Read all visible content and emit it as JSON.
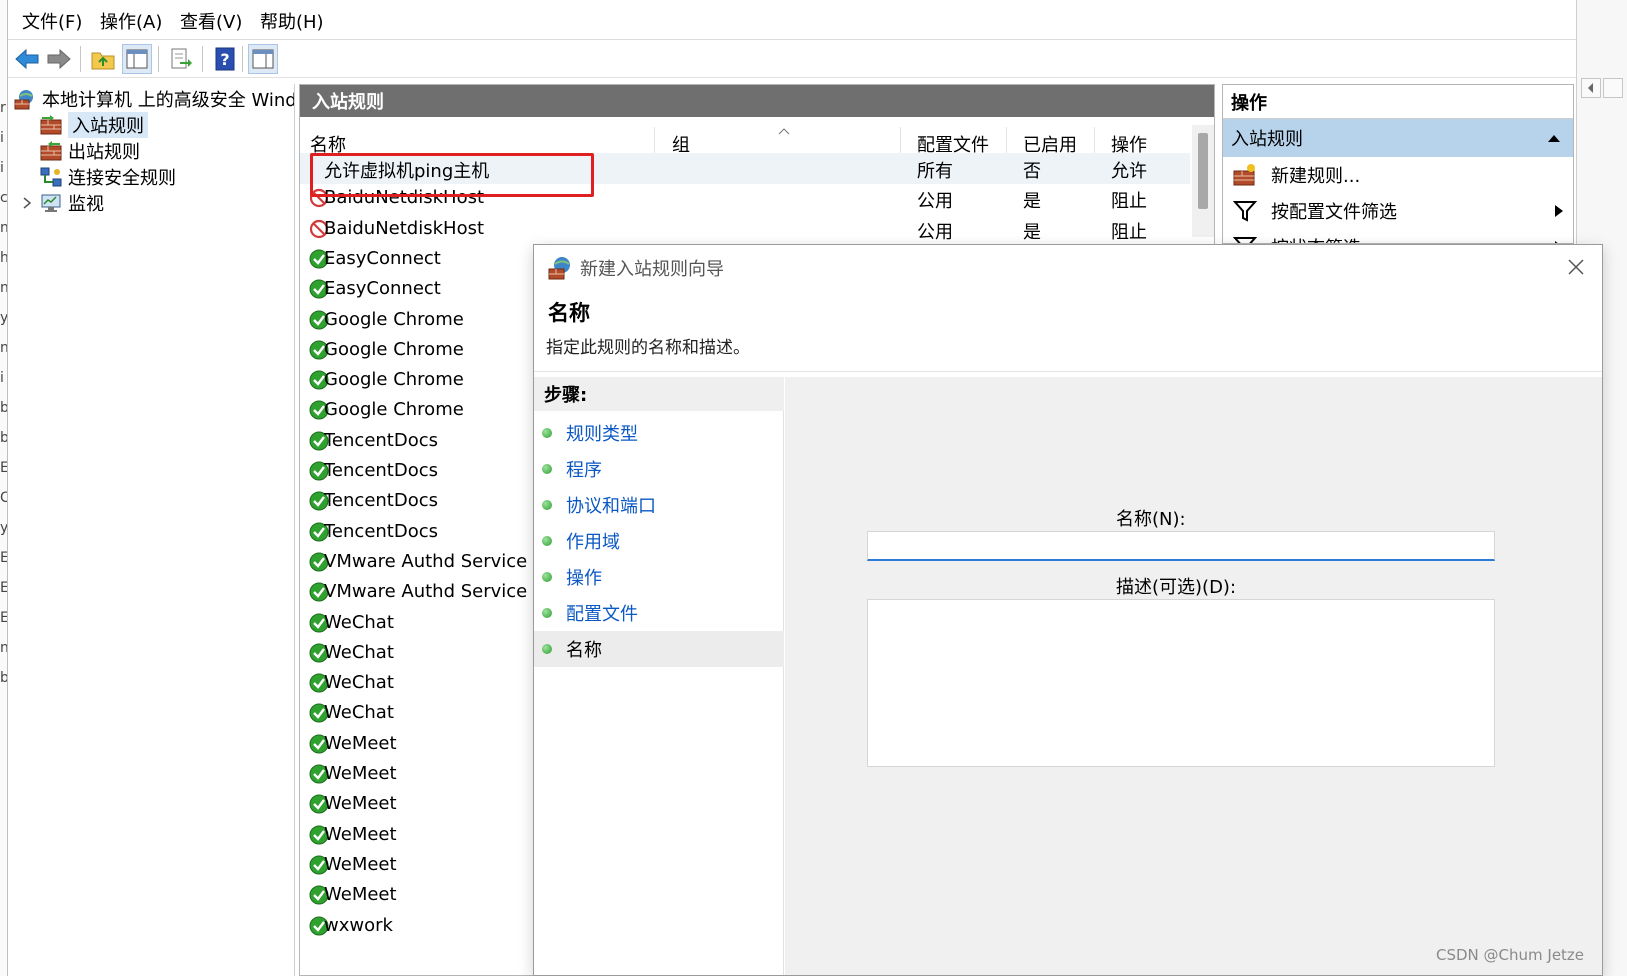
{
  "menubar": {
    "items": [
      "文件(F)",
      "操作(A)",
      "查看(V)",
      "帮助(H)"
    ]
  },
  "toolbar": {
    "buttons": [
      "back-arrow-icon",
      "forward-arrow-icon",
      "folder-up-icon",
      "show-hide-tree-icon",
      "export-list-icon",
      "help-icon",
      "show-hide-action-pane-icon"
    ]
  },
  "left_strip": {
    "chars": [
      "r",
      "i",
      "i",
      "c",
      "n",
      "h",
      "n",
      "y",
      "n",
      "i",
      "b",
      "b",
      "E",
      "C",
      "y",
      "E",
      "E",
      "E",
      "n",
      "b"
    ]
  },
  "tree": {
    "root": "本地计算机 上的高级安全 Windows",
    "items": [
      "入站规则",
      "出站规则",
      "连接安全规则",
      "监视"
    ]
  },
  "rules": {
    "panel_title": "入站规则",
    "columns": [
      "名称",
      "组",
      "配置文件",
      "已启用",
      "操作"
    ],
    "rows": [
      {
        "name": "允许虚拟机ping主机",
        "profile": "所有",
        "enabled": "否",
        "action": "允许",
        "icon": "none"
      },
      {
        "name": "BaiduNetdiskHost",
        "profile": "公用",
        "enabled": "是",
        "action": "阻止",
        "icon": "block"
      },
      {
        "name": "BaiduNetdiskHost",
        "profile": "公用",
        "enabled": "是",
        "action": "阻止",
        "icon": "block"
      },
      {
        "name": "EasyConnect",
        "icon": "allow"
      },
      {
        "name": "EasyConnect",
        "icon": "allow"
      },
      {
        "name": "Google Chrome",
        "icon": "allow"
      },
      {
        "name": "Google Chrome",
        "icon": "allow"
      },
      {
        "name": "Google Chrome",
        "icon": "allow"
      },
      {
        "name": "Google Chrome",
        "icon": "allow"
      },
      {
        "name": "TencentDocs",
        "icon": "allow"
      },
      {
        "name": "TencentDocs",
        "icon": "allow"
      },
      {
        "name": "TencentDocs",
        "icon": "allow"
      },
      {
        "name": "TencentDocs",
        "icon": "allow"
      },
      {
        "name": "VMware Authd Service",
        "icon": "allow"
      },
      {
        "name": "VMware Authd Service (",
        "icon": "allow"
      },
      {
        "name": "WeChat",
        "icon": "allow"
      },
      {
        "name": "WeChat",
        "icon": "allow"
      },
      {
        "name": "WeChat",
        "icon": "allow"
      },
      {
        "name": "WeChat",
        "icon": "allow"
      },
      {
        "name": "WeMeet",
        "icon": "allow"
      },
      {
        "name": "WeMeet",
        "icon": "allow"
      },
      {
        "name": "WeMeet",
        "icon": "allow"
      },
      {
        "name": "WeMeet",
        "icon": "allow"
      },
      {
        "name": "WeMeet",
        "icon": "allow"
      },
      {
        "name": "WeMeet",
        "icon": "allow"
      },
      {
        "name": "wxwork",
        "icon": "allow"
      }
    ]
  },
  "actions": {
    "title": "操作",
    "section": "入站规则",
    "items": [
      "新建规则...",
      "按配置文件筛选",
      "按状态筛选"
    ]
  },
  "dialog": {
    "title": "新建入站规则向导",
    "heading": "名称",
    "subheading": "指定此规则的名称和描述。",
    "steps_label": "步骤:",
    "steps": [
      "规则类型",
      "程序",
      "协议和端口",
      "作用域",
      "操作",
      "配置文件",
      "名称"
    ],
    "current_step": "名称",
    "name_label": "名称(N):",
    "name_value": "",
    "desc_label": "描述(可选)(D):",
    "desc_value": ""
  },
  "watermark": "CSDN @Chum Jetze",
  "colors": {
    "accent_blue": "#0b58c4",
    "highlight_red": "#e02020",
    "actions_section_bg": "#b7d3ec",
    "panel_header_bg": "#6f6f6f"
  }
}
